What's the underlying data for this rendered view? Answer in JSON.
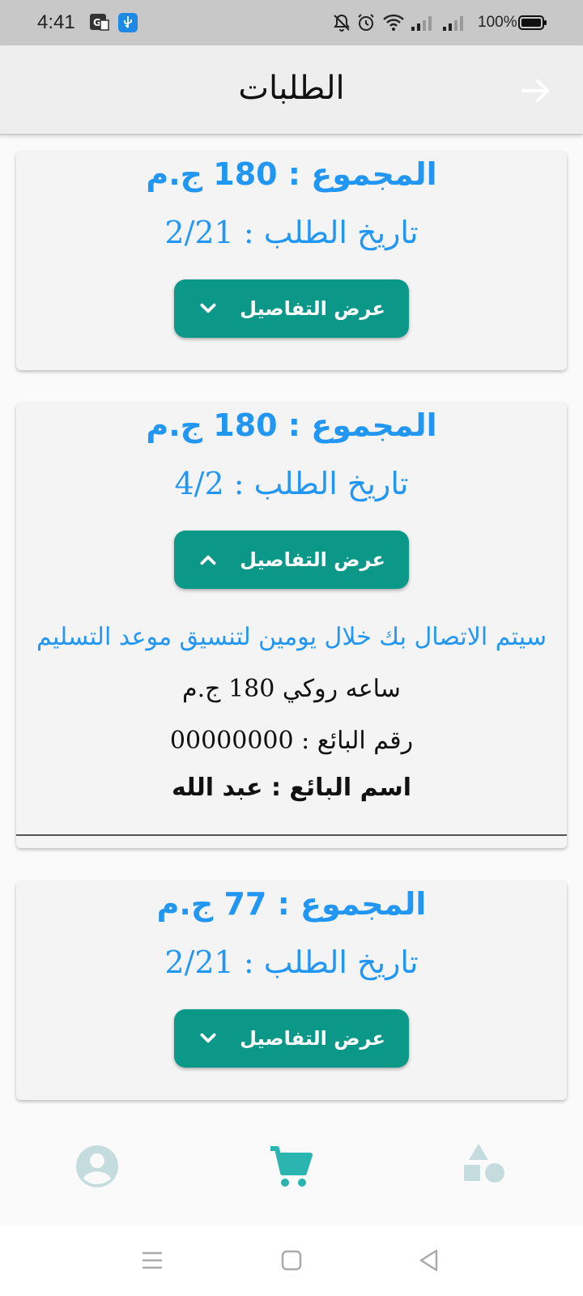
{
  "status_bar": {
    "time": "4:41",
    "battery": "100%"
  },
  "app_bar": {
    "title": "الطلبات"
  },
  "orders": [
    {
      "total": "المجموع : 180 ج.م",
      "date": "تاريخ الطلب  :  2/21",
      "button_label": "عرض التفاصيل",
      "expanded": false
    },
    {
      "total": "المجموع : 180 ج.م",
      "date": "تاريخ الطلب  :  4/2",
      "button_label": "عرض التفاصيل",
      "expanded": true,
      "details": {
        "message": "سيتم الاتصال بك خلال  يومين لتنسيق موعد التسليم",
        "item": "ساعه روكي 180 ج.م",
        "seller_number": "رقم البائع  :  00000000",
        "seller_name": "اسم البائع  :  عبد الله"
      }
    },
    {
      "total": "المجموع : 77 ج.م",
      "date": "تاريخ الطلب  :  2/21",
      "button_label": "عرض التفاصيل",
      "expanded": false
    }
  ],
  "bottom_nav": [
    {
      "icon": "account-icon",
      "active": false
    },
    {
      "icon": "cart-icon",
      "active": true
    },
    {
      "icon": "categories-icon",
      "active": false
    }
  ],
  "colors": {
    "accent": "#2196f3",
    "button": "#0b9888",
    "nav_active": "#2bb5b0",
    "nav_inactive": "#c5dcdf"
  }
}
